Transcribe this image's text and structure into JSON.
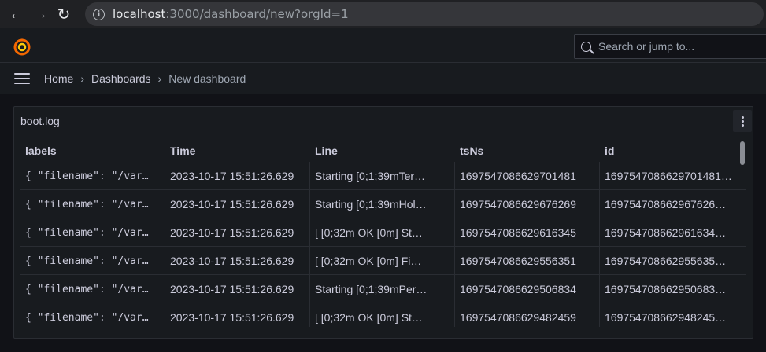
{
  "browser": {
    "url_host": "localhost",
    "url_rest": ":3000/dashboard/new?orgId=1"
  },
  "topbar": {
    "search_placeholder": "Search or jump to..."
  },
  "breadcrumb": {
    "items": [
      "Home",
      "Dashboards",
      "New dashboard"
    ],
    "separator": "›"
  },
  "panel": {
    "title": "boot.log",
    "columns": [
      "labels",
      "Time",
      "Line",
      "tsNs",
      "id"
    ],
    "rows": [
      [
        "{ \"filename\": \"/var…",
        "2023-10-17 15:51:26.629",
        "Starting    [0;1;39mTer…",
        "1697547086629701481",
        "1697547086629701481…"
      ],
      [
        "{ \"filename\": \"/var…",
        "2023-10-17 15:51:26.629",
        "Starting    [0;1;39mHol…",
        "1697547086629676269",
        "169754708662967626…"
      ],
      [
        "{ \"filename\": \"/var…",
        "2023-10-17 15:51:26.629",
        "[    [0;32m OK     [0m] St…",
        "1697547086629616345",
        "169754708662961634…"
      ],
      [
        "{ \"filename\": \"/var…",
        "2023-10-17 15:51:26.629",
        "[    [0;32m OK     [0m] Fi…",
        "1697547086629556351",
        "169754708662955635…"
      ],
      [
        "{ \"filename\": \"/var…",
        "2023-10-17 15:51:26.629",
        "Starting    [0;1;39mPer…",
        "1697547086629506834",
        "169754708662950683…"
      ],
      [
        "{ \"filename\": \"/var…",
        "2023-10-17 15:51:26.629",
        "[    [0;32m OK     [0m] St…",
        "1697547086629482459",
        "169754708662948245…"
      ]
    ]
  }
}
